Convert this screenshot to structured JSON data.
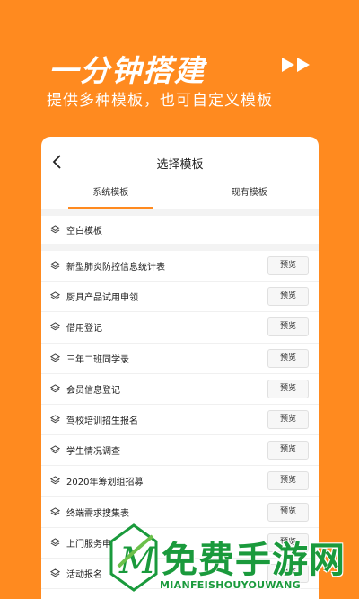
{
  "promo": {
    "title": "一分钟搭建",
    "subtitle": "提供多种模板，也可自定义模板"
  },
  "nav": {
    "title": "选择模板",
    "back_icon": "chevron-left-icon"
  },
  "tabs": [
    {
      "label": "系统模板",
      "active": true
    },
    {
      "label": "现有模板",
      "active": false
    }
  ],
  "blank_template": {
    "label": "空白模板"
  },
  "templates": [
    {
      "label": "新型肺炎防控信息统计表",
      "action": "预览"
    },
    {
      "label": "厨具产品试用申领",
      "action": "预览"
    },
    {
      "label": "借用登记",
      "action": "预览"
    },
    {
      "label": "三年二班同学录",
      "action": "预览"
    },
    {
      "label": "会员信息登记",
      "action": "预览"
    },
    {
      "label": "驾校培训招生报名",
      "action": "预览"
    },
    {
      "label": "学生情况调查",
      "action": "预览"
    },
    {
      "label": "2020年筹划组招募",
      "action": "预览"
    },
    {
      "label": "终端需求搜集表",
      "action": "预览"
    },
    {
      "label": "上门服务申",
      "action": "预览"
    },
    {
      "label": "活动报名",
      "action": "预览"
    }
  ],
  "watermark": {
    "cn": "免费手游网",
    "en": "MIANFEISHOUYOUWANG"
  },
  "colors": {
    "background": "#ff8a1f",
    "accent": "#ff8a1f",
    "watermark": "#1a9a3c"
  }
}
